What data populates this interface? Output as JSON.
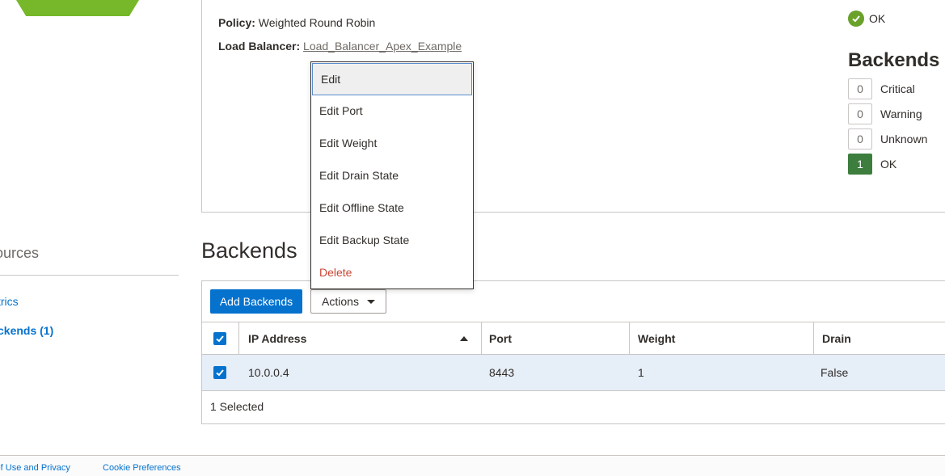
{
  "nav": {
    "resources_title": "ources",
    "items": [
      {
        "label": "trics"
      },
      {
        "label": "ckends (1)"
      }
    ]
  },
  "details": {
    "policy_label": "Policy:",
    "policy_value": "Weighted Round Robin",
    "lb_label": "Load Balancer:",
    "lb_value": "Load_Balancer_Apex_Example"
  },
  "status": {
    "text": "OK",
    "icon": "check-circle-icon",
    "color": "#6aa12b"
  },
  "health": {
    "title": "Backends",
    "rows": [
      {
        "count": "0",
        "label": "Critical"
      },
      {
        "count": "0",
        "label": "Warning"
      },
      {
        "count": "0",
        "label": "Unknown"
      },
      {
        "count": "1",
        "label": "OK"
      }
    ]
  },
  "backends": {
    "title": "Backends",
    "add_button": "Add Backends",
    "actions_button": "Actions",
    "columns": [
      "IP Address",
      "Port",
      "Weight",
      "Drain"
    ],
    "rows": [
      {
        "ip": "10.0.0.4",
        "port": "8443",
        "weight": "1",
        "drain": "False"
      }
    ],
    "selected_text": "1 Selected"
  },
  "menu": {
    "items": [
      "Edit",
      "Edit Port",
      "Edit Weight",
      "Edit Drain State",
      "Edit Offline State",
      "Edit Backup State",
      "Delete"
    ]
  },
  "footer": {
    "links": [
      "s of Use and Privacy",
      "Cookie Preferences"
    ]
  },
  "colors": {
    "accent": "#0572ce",
    "ok_green": "#3d7d3d",
    "danger": "#c74634"
  }
}
